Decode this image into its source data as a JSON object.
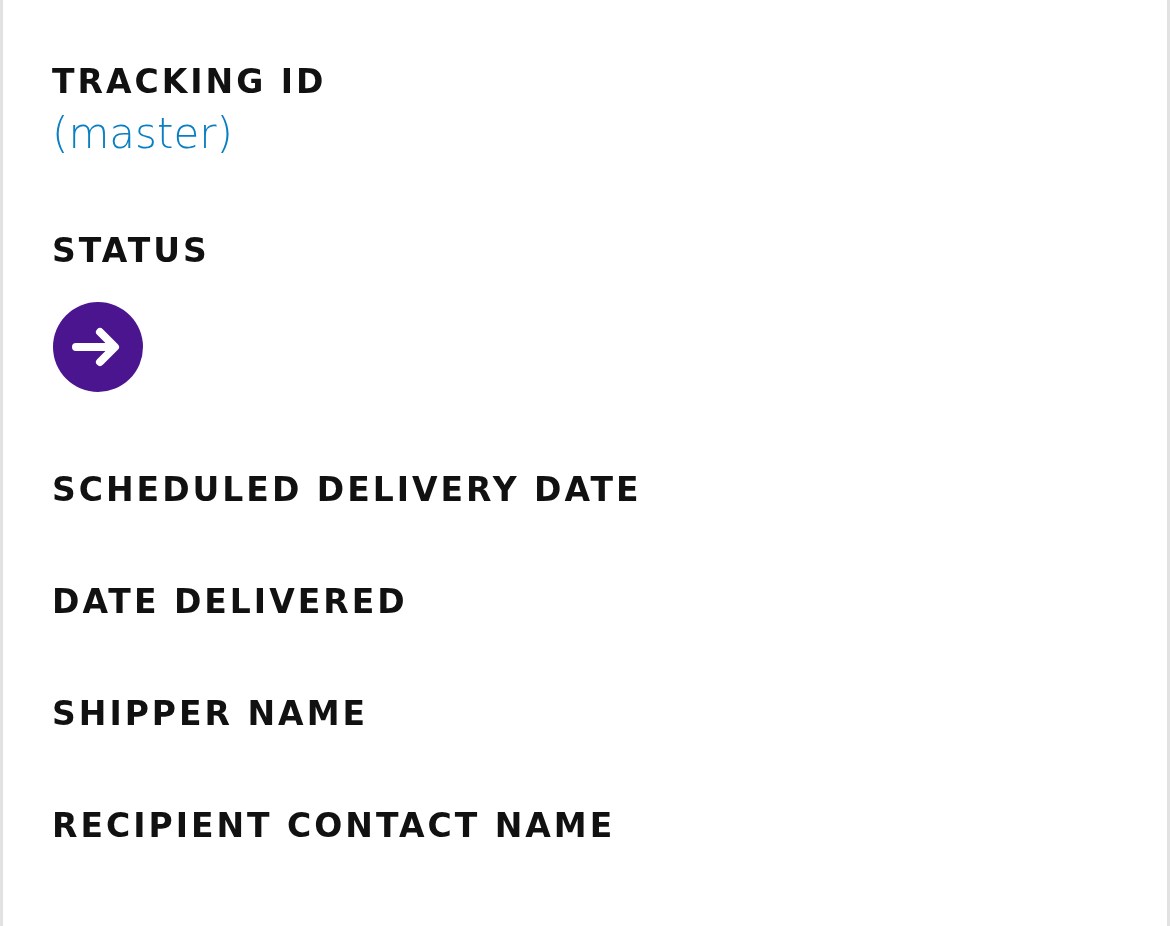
{
  "fields": [
    {
      "label": "TRACKING ID",
      "kind": "link",
      "value": "(master)"
    },
    {
      "label": "STATUS",
      "kind": "status"
    },
    {
      "label": "SCHEDULED DELIVERY DATE",
      "kind": "empty"
    },
    {
      "label": "DATE DELIVERED",
      "kind": "empty"
    },
    {
      "label": "SHIPPER NAME",
      "kind": "empty"
    },
    {
      "label": "RECIPIENT CONTACT NAME",
      "kind": "empty"
    }
  ]
}
